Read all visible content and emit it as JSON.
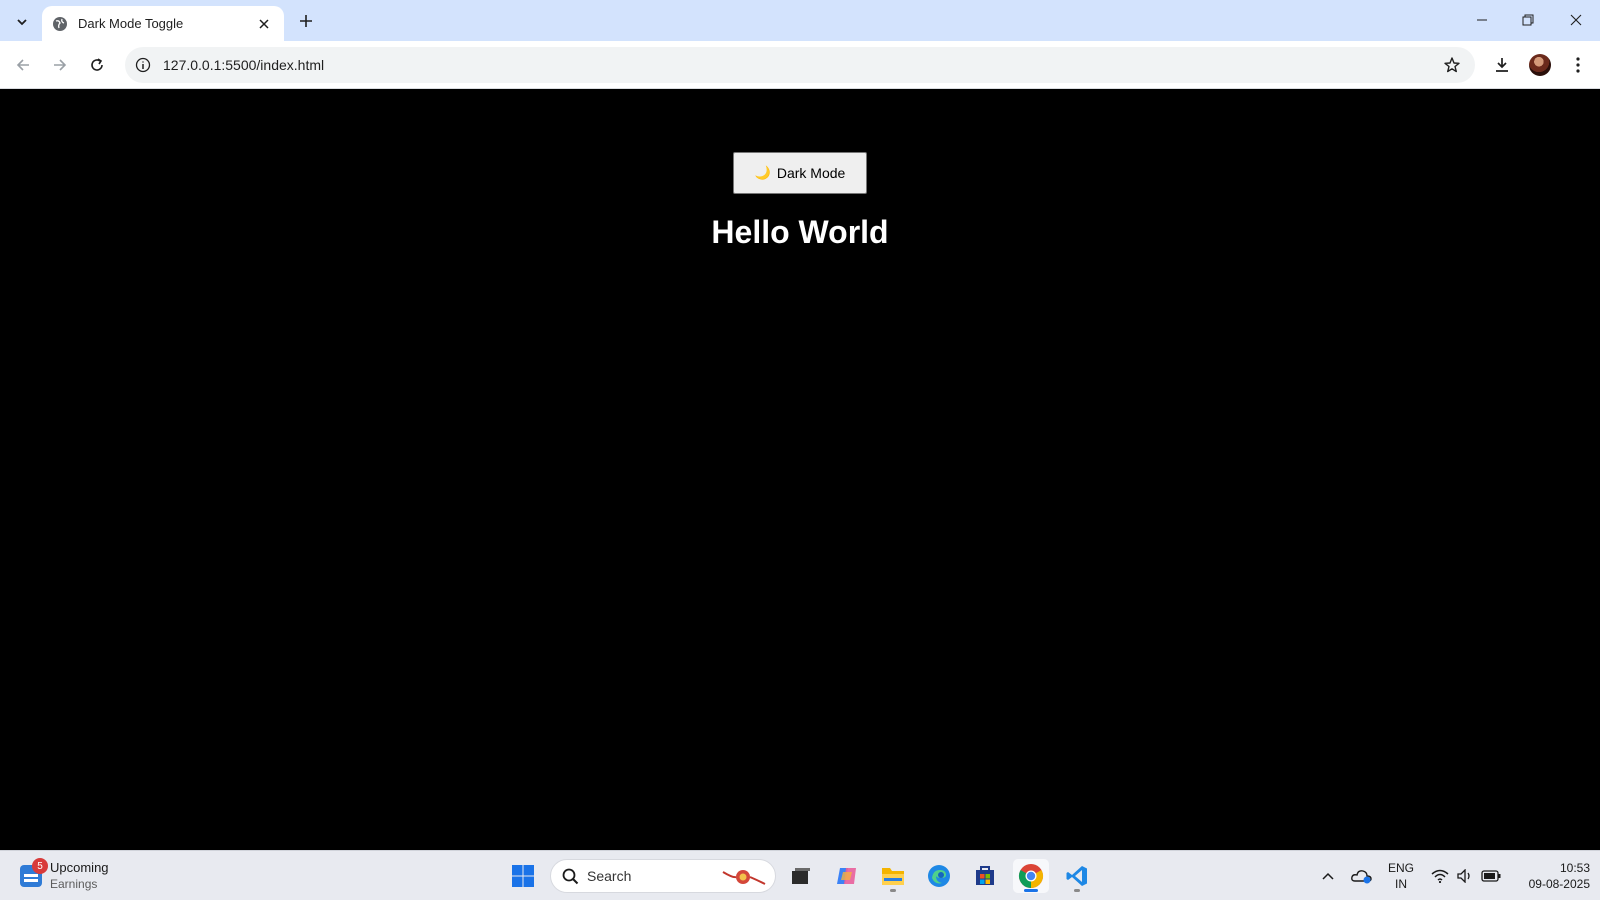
{
  "browser": {
    "tab_title": "Dark Mode Toggle",
    "url": "127.0.0.1:5500/index.html"
  },
  "page": {
    "toggle_label": "Dark Mode",
    "toggle_emoji": "🌙",
    "heading": "Hello World",
    "background": "#000000",
    "text_color": "#ffffff"
  },
  "taskbar": {
    "widget_badge": "5",
    "widget_title": "Upcoming",
    "widget_subtitle": "Earnings",
    "search_label": "Search",
    "lang_primary": "ENG",
    "lang_secondary": "IN",
    "time": "10:53",
    "date": "09-08-2025"
  },
  "icons": [
    "tab-search-icon",
    "globe-icon",
    "close-icon",
    "plus-icon",
    "minimize-icon",
    "restore-icon",
    "window-close-icon",
    "back-icon",
    "forward-icon",
    "reload-icon",
    "info-icon",
    "star-icon",
    "download-icon",
    "more-icon",
    "windows-start-icon",
    "search-icon",
    "task-view-icon",
    "copilot-icon",
    "file-explorer-icon",
    "edge-icon",
    "store-icon",
    "chrome-icon",
    "vscode-icon",
    "chevron-up-icon",
    "onedrive-icon",
    "wifi-icon",
    "volume-icon",
    "battery-icon"
  ]
}
